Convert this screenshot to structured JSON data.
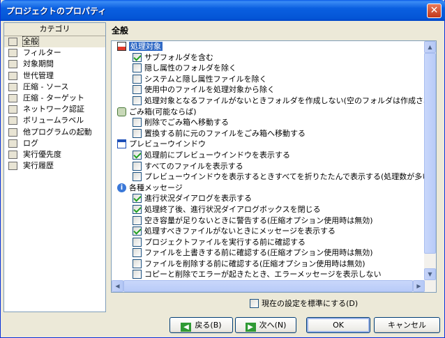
{
  "window": {
    "title": "プロジェクトのプロパティ",
    "close_glyph": "✕"
  },
  "categories": {
    "header": "カテゴリ",
    "items": [
      {
        "label": "全般",
        "icon": "folder-icon",
        "selected": true
      },
      {
        "label": "フィルター",
        "icon": "filter-icon"
      },
      {
        "label": "対象期間",
        "icon": "calendar-icon"
      },
      {
        "label": "世代管理",
        "icon": "generation-icon"
      },
      {
        "label": "圧縮 - ソース",
        "icon": "archive-icon"
      },
      {
        "label": "圧縮 - ターゲット",
        "icon": "archive-icon"
      },
      {
        "label": "ネットワーク認証",
        "icon": "network-icon"
      },
      {
        "label": "ボリュームラベル",
        "icon": "drive-icon"
      },
      {
        "label": "他プログラムの起動",
        "icon": "program-icon"
      },
      {
        "label": "ログ",
        "icon": "log-icon"
      },
      {
        "label": "実行優先度",
        "icon": "priority-icon"
      },
      {
        "label": "実行履歴",
        "icon": "history-icon"
      }
    ]
  },
  "main": {
    "title": "全般",
    "groups": [
      {
        "label": "処理対象",
        "icon": "target-icon",
        "selected": true,
        "options": [
          {
            "label": "サブフォルダを含む",
            "checked": true
          },
          {
            "label": "隠し属性のフォルダを除く",
            "checked": false
          },
          {
            "label": "システムと隠し属性ファイルを除く",
            "checked": false
          },
          {
            "label": "使用中のファイルを処理対象から除く",
            "checked": false
          },
          {
            "label": "処理対象となるファイルがないときフォルダを作成しない(空のフォルダは作成されない)",
            "checked": false
          }
        ]
      },
      {
        "label": "ごみ箱(可能ならば)",
        "icon": "recycle-bin-icon",
        "options": [
          {
            "label": "削除でごみ箱へ移動する",
            "checked": false
          },
          {
            "label": "置換する前に元のファイルをごみ箱へ移動する",
            "checked": false
          }
        ]
      },
      {
        "label": "プレビューウインドウ",
        "icon": "preview-window-icon",
        "options": [
          {
            "label": "処理前にプレビューウインドウを表示する",
            "checked": true
          },
          {
            "label": "すべてのファイルを表示する",
            "checked": false
          },
          {
            "label": "プレビューウインドウを表示するときすべてを折りたたんで表示する(処理数が多いとき退",
            "checked": false
          }
        ]
      },
      {
        "label": "各種メッセージ",
        "icon": "info-icon",
        "options": [
          {
            "label": "進行状況ダイアログを表示する",
            "checked": true
          },
          {
            "label": "処理終了後、進行状況ダイアログボックスを閉じる",
            "checked": true
          },
          {
            "label": "空き容量が足りないときに警告する(圧縮オプション使用時は無効)",
            "checked": false
          },
          {
            "label": "処理すべきファイルがないときにメッセージを表示する",
            "checked": true
          },
          {
            "label": "プロジェクトファイルを実行する前に確認する",
            "checked": false
          },
          {
            "label": "ファイルを上書きする前に確認する(圧縮オプション使用時は無効)",
            "checked": false
          },
          {
            "label": "ファイルを削除する前に確認する(圧縮オプション使用時は無効)",
            "checked": false
          },
          {
            "label": "コピーと削除でエラーが起きたとき、エラーメッセージを表示しない",
            "checked": false
          }
        ]
      }
    ],
    "default_checkbox": {
      "label": "現在の設定を標準にする(D)",
      "checked": false
    }
  },
  "buttons": {
    "back": "戻る(B)",
    "next": "次へ(N)",
    "ok": "OK",
    "cancel": "キャンセル"
  },
  "colors": {
    "titlebar": "#0a5fe0",
    "selection": "#316ac5",
    "face": "#ece9d8",
    "check": "#21a121"
  }
}
